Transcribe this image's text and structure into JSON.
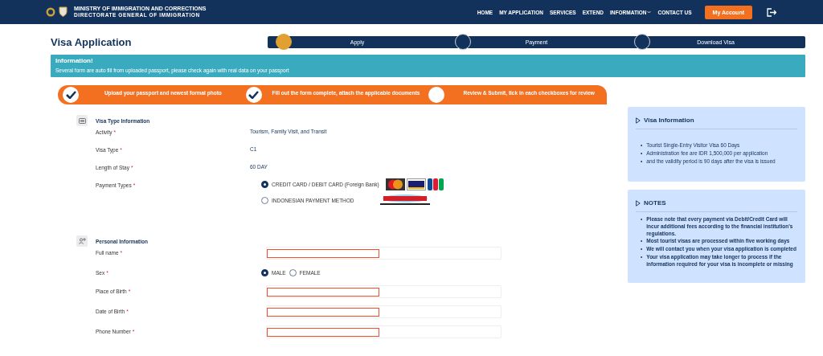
{
  "header": {
    "org": "MINISTRY OF IMMIGRATION AND CORRECTIONS",
    "sub": "DIRECTORATE GENERAL OF IMMIGRATION",
    "nav": [
      {
        "label": "HOME",
        "dropdown": false
      },
      {
        "label": "MY APPLICATION",
        "dropdown": false
      },
      {
        "label": "SERVICES",
        "dropdown": false
      },
      {
        "label": "EXTEND",
        "dropdown": false
      },
      {
        "label": "INFORMATION",
        "dropdown": true
      },
      {
        "label": "CONTACT US",
        "dropdown": false
      }
    ],
    "account_button": "My Account"
  },
  "page_title": "Visa Application",
  "progress": [
    {
      "label": "Apply",
      "selected": true
    },
    {
      "label": "Payment",
      "selected": false
    },
    {
      "label": "Download Visa",
      "selected": false
    }
  ],
  "info": {
    "title": "Information!",
    "text": "Several form are auto fill from uploaded passport, please check again with real data on your passport"
  },
  "form_steps": [
    {
      "label": "Upload your passport and newest formal photo",
      "done": true
    },
    {
      "label": "Fill out the form complete, attach the applicable documents",
      "done": true
    },
    {
      "label": "Review & Submit, tick in each checkboxes for review",
      "done": false
    }
  ],
  "sections": [
    {
      "title": "Visa Type Information",
      "fields": [
        {
          "kind": "text",
          "label": "Activity",
          "mark": "*",
          "value": "Tourism, Family Visit, and Transit"
        },
        {
          "kind": "text",
          "label": "Visa Type",
          "mark": "*",
          "value": "C1"
        },
        {
          "kind": "text",
          "label": "Length of Stay",
          "mark": "*",
          "value": "60 DAY"
        },
        {
          "kind": "payment",
          "label": "Payment Types",
          "mark": "*",
          "options": [
            {
              "label": "CREDIT CARD / DEBIT CARD (Foreign Bank)",
              "selected": true
            },
            {
              "label": "INDONESIAN PAYMENT METHOD",
              "selected": false
            }
          ]
        }
      ]
    },
    {
      "title": "Personal Information",
      "fields": [
        {
          "kind": "input",
          "label": "Full name",
          "mark": "*",
          "redacted": true
        },
        {
          "kind": "radio",
          "label": "Sex",
          "mark": "*",
          "options": [
            {
              "label": "MALE",
              "selected": true
            },
            {
              "label": "FEMALE",
              "selected": false
            }
          ]
        },
        {
          "kind": "input",
          "label": "Place of Birth",
          "mark": "*",
          "redacted": true
        },
        {
          "kind": "input",
          "label": "Date of Birth",
          "mark": "*",
          "redacted": true
        },
        {
          "kind": "input",
          "label": "Phone Number",
          "mark": "*",
          "redacted": true
        }
      ]
    }
  ],
  "sidebar": [
    {
      "title": "Visa Information",
      "bold": false,
      "items": [
        {
          "marker": "•",
          "text": "Tourist Single-Entry Visitor Visa 60 Days"
        },
        {
          "marker": "•",
          "text": "Administration fee are IDR 1,500,000 per application"
        },
        {
          "marker": "•",
          "text": "and the validity period is 90 days after the visa is issued"
        }
      ]
    },
    {
      "title": "NOTES",
      "bold": true,
      "items": [
        {
          "marker": "•",
          "text": "Please note that every payment via Debit/Credit Card will incur additional fees according to the financial institution's regulations."
        },
        {
          "marker": "•",
          "text": "Most tourist visas are processed within five working days"
        },
        {
          "marker": "•",
          "text": "We will contact you when your visa application is completed"
        },
        {
          "marker": "•",
          "text": "Your visa application may take longer to process if the information required for your visa is incomplete or missing"
        }
      ]
    }
  ]
}
